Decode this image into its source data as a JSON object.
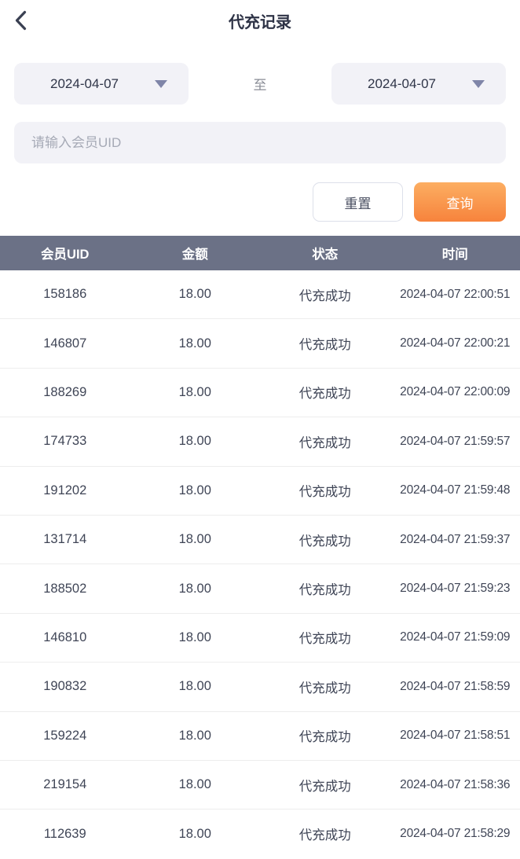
{
  "header": {
    "title": "代充记录"
  },
  "filters": {
    "date_from": "2024-04-07",
    "date_to": "2024-04-07",
    "to_label": "至",
    "uid_placeholder": "请输入会员UID",
    "reset_label": "重置",
    "search_label": "查询"
  },
  "table": {
    "columns": [
      "会员UID",
      "金额",
      "状态",
      "时间"
    ],
    "rows": [
      [
        "158186",
        "18.00",
        "代充成功",
        "2024-04-07 22:00:51"
      ],
      [
        "146807",
        "18.00",
        "代充成功",
        "2024-04-07 22:00:21"
      ],
      [
        "188269",
        "18.00",
        "代充成功",
        "2024-04-07 22:00:09"
      ],
      [
        "174733",
        "18.00",
        "代充成功",
        "2024-04-07 21:59:57"
      ],
      [
        "191202",
        "18.00",
        "代充成功",
        "2024-04-07 21:59:48"
      ],
      [
        "131714",
        "18.00",
        "代充成功",
        "2024-04-07 21:59:37"
      ],
      [
        "188502",
        "18.00",
        "代充成功",
        "2024-04-07 21:59:23"
      ],
      [
        "146810",
        "18.00",
        "代充成功",
        "2024-04-07 21:59:09"
      ],
      [
        "190832",
        "18.00",
        "代充成功",
        "2024-04-07 21:58:59"
      ],
      [
        "159224",
        "18.00",
        "代充成功",
        "2024-04-07 21:58:51"
      ],
      [
        "219154",
        "18.00",
        "代充成功",
        "2024-04-07 21:58:36"
      ],
      [
        "112639",
        "18.00",
        "代充成功",
        "2024-04-07 21:58:29"
      ]
    ]
  },
  "colors": {
    "accent_orange_top": "#fcae62",
    "accent_orange_bottom": "#f7833c",
    "table_header_bg": "#6b7186",
    "field_bg": "#f2f2f7",
    "caret": "#7f85a8",
    "text_dark": "#2e3346",
    "text_cell": "#3f4556",
    "separator": "#ededed"
  }
}
